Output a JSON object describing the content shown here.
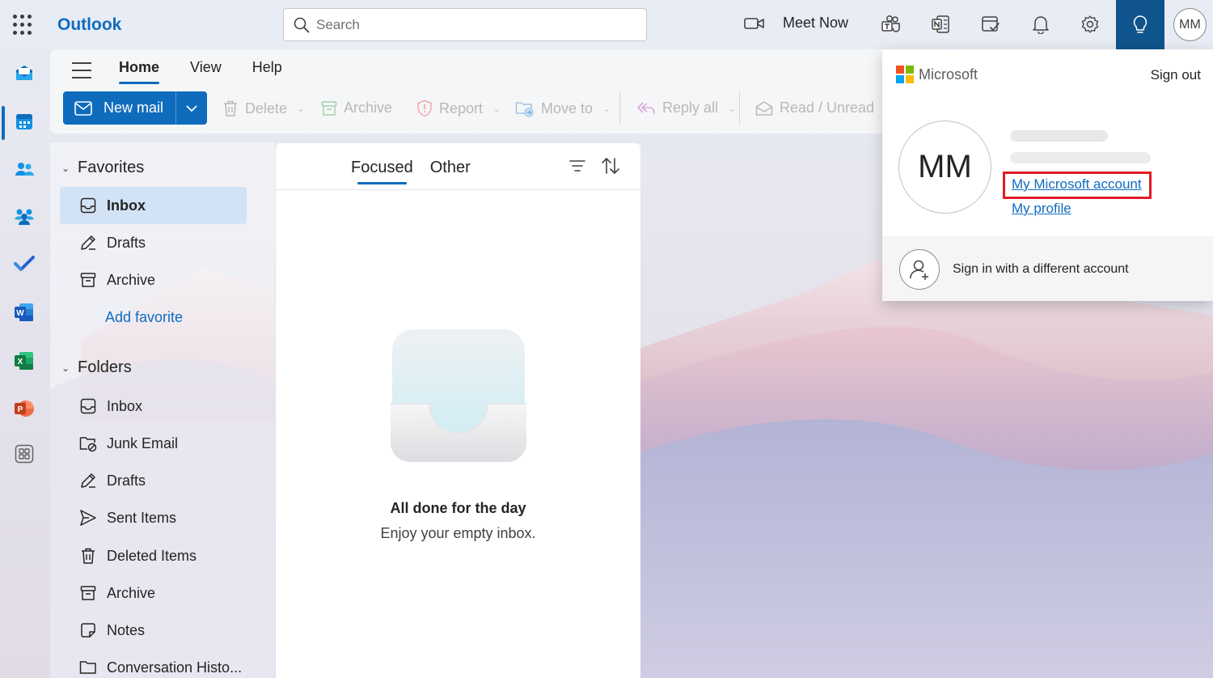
{
  "topbar": {
    "app_name": "Outlook",
    "search_placeholder": "Search",
    "meet_now": "Meet Now",
    "avatar_initials": "MM"
  },
  "ribbon": {
    "tabs": [
      {
        "label": "Home",
        "active": true
      },
      {
        "label": "View",
        "active": false
      },
      {
        "label": "Help",
        "active": false
      }
    ],
    "new_mail": "New mail",
    "commands": {
      "delete": "Delete",
      "archive": "Archive",
      "report": "Report",
      "move_to": "Move to",
      "reply_all": "Reply all",
      "read_unread": "Read / Unread"
    }
  },
  "nav": {
    "favorites_label": "Favorites",
    "favorites": [
      {
        "label": "Inbox",
        "icon": "inbox-icon",
        "selected": true
      },
      {
        "label": "Drafts",
        "icon": "pencil-icon",
        "selected": false
      },
      {
        "label": "Archive",
        "icon": "archive-icon",
        "selected": false
      }
    ],
    "add_favorite": "Add favorite",
    "folders_label": "Folders",
    "folders": [
      {
        "label": "Inbox",
        "icon": "inbox-icon"
      },
      {
        "label": "Junk Email",
        "icon": "junk-icon"
      },
      {
        "label": "Drafts",
        "icon": "pencil-icon"
      },
      {
        "label": "Sent Items",
        "icon": "send-icon"
      },
      {
        "label": "Deleted Items",
        "icon": "trash-icon"
      },
      {
        "label": "Archive",
        "icon": "archive-icon"
      },
      {
        "label": "Notes",
        "icon": "note-icon"
      },
      {
        "label": "Conversation Histo...",
        "icon": "folder-icon"
      }
    ]
  },
  "message_list": {
    "tabs": [
      {
        "label": "Focused",
        "active": true
      },
      {
        "label": "Other",
        "active": false
      }
    ],
    "empty_title": "All done for the day",
    "empty_subtitle": "Enjoy your empty inbox."
  },
  "account_flyout": {
    "brand": "Microsoft",
    "sign_out": "Sign out",
    "avatar_initials": "MM",
    "my_account": "My Microsoft account",
    "my_profile": "My profile",
    "different_account": "Sign in with a different account"
  },
  "colors": {
    "accent": "#0f6cbd",
    "highlight_box": "#e01b24",
    "tip_button": "#0f548c"
  }
}
